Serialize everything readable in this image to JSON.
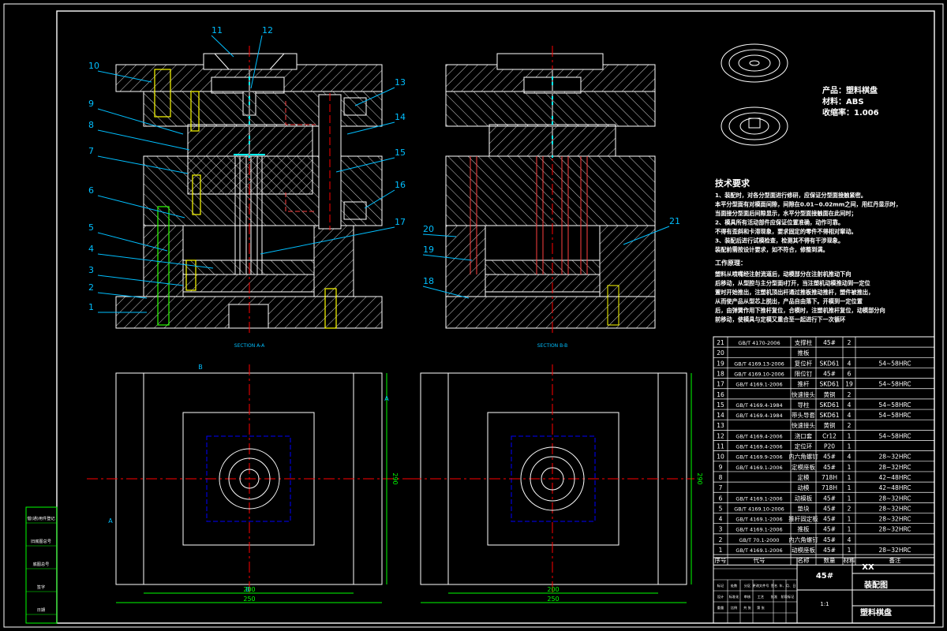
{
  "callouts": [
    "1",
    "2",
    "3",
    "4",
    "5",
    "6",
    "7",
    "8",
    "9",
    "10",
    "11",
    "12",
    "13",
    "14",
    "15",
    "16",
    "17",
    "18",
    "19",
    "20",
    "21"
  ],
  "section_labels": {
    "a": "SECTION A-A",
    "b": "SECTION B-B"
  },
  "cut_letters": {
    "a": "A",
    "b": "B"
  },
  "dimensions": {
    "inner_width": "200",
    "outer_width": "250",
    "height": "290"
  },
  "product": {
    "name": "产品：塑料棋盘",
    "material": "材料：ABS",
    "shrinkage": "收缩率：1.006"
  },
  "tech_requirements": {
    "title": "技术要求",
    "lines": [
      "1、装配时，对各分型面进行修研，应保证分型面接触紧密。",
      "本平分型面有对模面间隙，间隙在0.01~0.02mm之间，用红丹显示时，",
      "当面接分型面后间隙显示，水平分型面接触面在此间时；",
      "2、模具所有活动部件应保证位置准确，动作可靠。",
      "不得有歪斜和卡滞现象，要求固定的零件不得相对窜动。",
      "3、装配后进行试模检查，检测其不得有干涉现象。",
      "装配前需按设计要求，如不符合，修整到满。"
    ]
  },
  "work_process": {
    "title": "工作原理：",
    "lines": [
      "塑料从喷嘴经注射流道后，动模部分在注射机推动下向",
      "后移动，从型腔与主分型面Ⅰ打开，当注塑机动模推动到一定位",
      "置时开始推出，注塑机顶出杆通过推板推动推杆，塑件被推出，",
      "从而使产品从型芯上脱出，产品自由落下。开模到一定位置",
      "后，由弹簧作用下推杆复位，合模时，注塑机推杆复位，动模部分向",
      "前移动，使模具与定模又重合至一起进行下一次循环"
    ]
  },
  "bom": {
    "headers": [
      "序号",
      "代号",
      "名称",
      "数量",
      "材料",
      "备注"
    ],
    "rows": [
      [
        "21",
        "GB/T 4170-2006",
        "支撑柱",
        "45#",
        "2",
        ""
      ],
      [
        "20",
        "",
        "推板",
        "",
        "",
        ""
      ],
      [
        "19",
        "GB/T 4169.13-2006",
        "复位杆",
        "SKD61",
        "4",
        "54~58HRC"
      ],
      [
        "18",
        "GB/T 4169.10-2006",
        "限位钉",
        "45#",
        "6",
        ""
      ],
      [
        "17",
        "GB/T 4169.1-2006",
        "推杆",
        "SKD61",
        "19",
        "54~58HRC"
      ],
      [
        "16",
        "",
        "快速接头",
        "黄铜",
        "2",
        ""
      ],
      [
        "15",
        "GB/T 4169.4-1984",
        "导柱",
        "SKD61",
        "4",
        "54~58HRC"
      ],
      [
        "14",
        "GB/T 4169.4-1984",
        "带头导套",
        "SKD61",
        "4",
        "54~58HRC"
      ],
      [
        "13",
        "",
        "快速接头",
        "黄铜",
        "2",
        ""
      ],
      [
        "12",
        "GB/T 4169.4-2006",
        "浇口套",
        "Cr12",
        "1",
        "54~58HRC"
      ],
      [
        "11",
        "GB/T 4169.4-2006",
        "定位环",
        "P20",
        "1",
        ""
      ],
      [
        "10",
        "GB/T 4169.9-2006",
        "内六角螺钉",
        "45#",
        "4",
        "28~32HRC"
      ],
      [
        "9",
        "GB/T 4169.1-2006",
        "定模座板",
        "45#",
        "1",
        "28~32HRC"
      ],
      [
        "8",
        "",
        "定模",
        "718H",
        "1",
        "42~48HRC"
      ],
      [
        "7",
        "",
        "动模",
        "718H",
        "1",
        "42~48HRC"
      ],
      [
        "6",
        "GB/T 4169.1-2006",
        "动模板",
        "45#",
        "1",
        "28~32HRC"
      ],
      [
        "5",
        "GB/T 4169.10-2006",
        "垫块",
        "45#",
        "2",
        "28~32HRC"
      ],
      [
        "4",
        "GB/T 4169.1-2006",
        "推杆固定板",
        "45#",
        "1",
        "28~32HRC"
      ],
      [
        "3",
        "GB/T 4169.1-2006",
        "推板",
        "45#",
        "1",
        "28~32HRC"
      ],
      [
        "2",
        "GB/T 70.1-2000",
        "内六角螺钉",
        "45#",
        "4",
        ""
      ],
      [
        "1",
        "GB/T 4169.1-2006",
        "动模座板",
        "45#",
        "1",
        "28~32HRC"
      ]
    ]
  },
  "title_block": {
    "material": "45#",
    "company": "XX",
    "drawing_type": "装配图",
    "part_name": "塑料棋盘",
    "scale": "1:1",
    "small_labels": [
      "标记",
      "处数",
      "分区",
      "更改文件号",
      "签名",
      "年、月、日",
      "设计",
      "标准化",
      "审核",
      "工艺",
      "批准",
      "阶段标记",
      "重量",
      "比例",
      "共 张",
      "第 张"
    ]
  },
  "side_stamp": {
    "lines": [
      "借(通)用件登记",
      "旧底图总号",
      "底图总号",
      "签字",
      "日期"
    ]
  },
  "colors": {
    "background": "#000000",
    "frame": "#ffffff",
    "line": "#ffffff",
    "hidden": "#0000ff",
    "center": "#ff0000",
    "callout": "#00bfff",
    "hatch": "#cfcfcf",
    "bolt": "#ffff00",
    "green": "#00ff00"
  }
}
